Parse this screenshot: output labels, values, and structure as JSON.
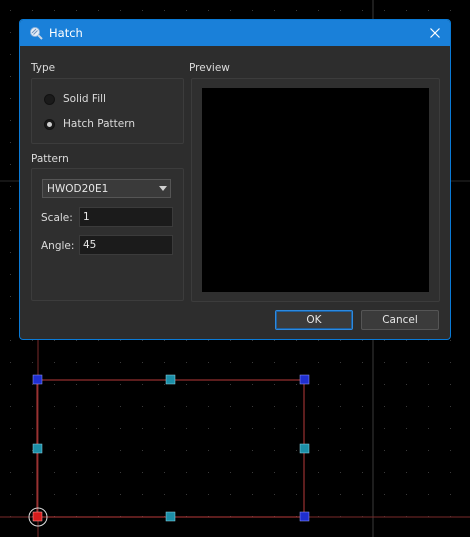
{
  "dialog": {
    "title": "Hatch",
    "title_icon": "hatch-magnifier-icon",
    "close_icon": "close-icon"
  },
  "type_section": {
    "label": "Type",
    "options": [
      {
        "label": "Solid Fill",
        "checked": false
      },
      {
        "label": "Hatch Pattern",
        "checked": true
      }
    ]
  },
  "pattern_section": {
    "label": "Pattern",
    "selected_pattern": "HWOD20E1",
    "scale_label": "Scale:",
    "scale_value": "1",
    "angle_label": "Angle:",
    "angle_value": "45"
  },
  "preview_section": {
    "label": "Preview"
  },
  "buttons": {
    "ok": "OK",
    "cancel": "Cancel"
  },
  "colors": {
    "accent": "#1a80d9",
    "dialog_bg": "#2d2d2d",
    "canvas_bg": "#000000",
    "selection_line": "#b83a3a",
    "grip_blue": "#1f2fd0",
    "grip_cyan": "#1c8fa8",
    "grip_red": "#d61c1c"
  }
}
